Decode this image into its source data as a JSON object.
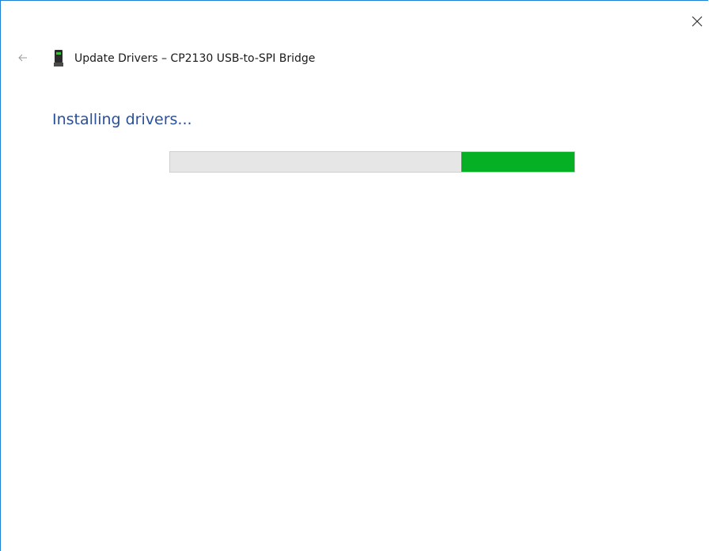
{
  "window": {
    "title": "Update Drivers – CP2130 USB-to-SPI Bridge",
    "close_icon": "close-icon",
    "back_icon": "back-arrow-icon",
    "device_icon": "usb-device-icon"
  },
  "status": {
    "heading": "Installing drivers..."
  },
  "progress": {
    "mode": "indeterminate-marquee",
    "segment_start_fraction": 0.72,
    "segment_length_fraction": 0.28,
    "fill_color": "#06b025",
    "track_color": "#e6e6e6"
  },
  "colors": {
    "accent_border": "#1e7fd6",
    "heading_text": "#2a4f9c"
  }
}
